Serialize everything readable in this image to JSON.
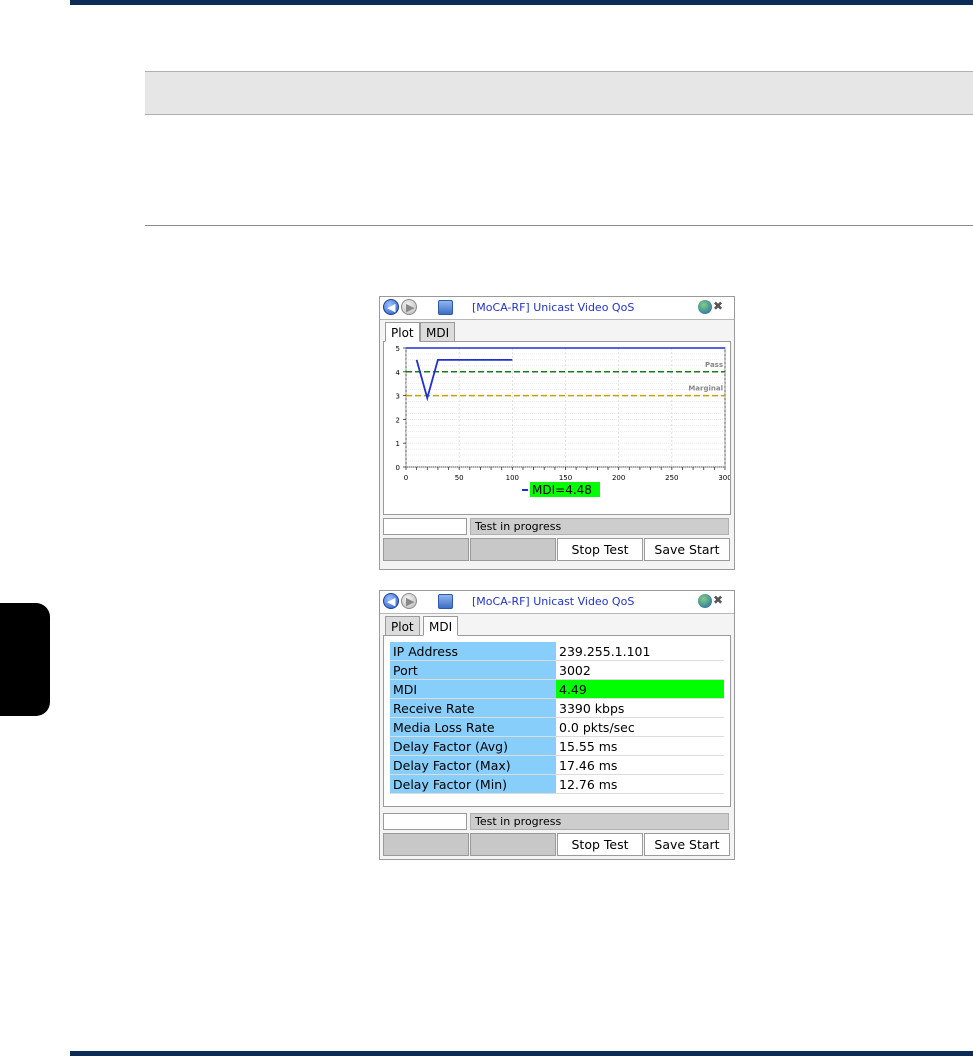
{
  "device_title": "[MoCA-RF] Unicast Video QoS",
  "tabs": [
    "Plot",
    "MDI"
  ],
  "status": "Test in progress",
  "softkeys": {
    "stop": "Stop Test",
    "save": "Save Start"
  },
  "plot": {
    "legend_label": "MDI=4.48",
    "pass_label": "Pass",
    "marginal_label": "Marginal"
  },
  "chart_data": {
    "type": "line",
    "x_ticks": [
      "0",
      "50",
      "100",
      "150",
      "200",
      "250",
      "300"
    ],
    "y_ticks": [
      "0",
      "1",
      "2",
      "3",
      "4",
      "5"
    ],
    "xlim": [
      0,
      300
    ],
    "ylim": [
      0,
      5
    ],
    "series": [
      {
        "name": "MDI=4.48",
        "color": "#1f2fd6",
        "x": [
          10,
          20,
          30,
          100
        ],
        "y": [
          4.5,
          2.9,
          4.5,
          4.5
        ]
      }
    ],
    "thresholds": [
      {
        "name": "Pass",
        "value": 4,
        "color": "#1a7a1a"
      },
      {
        "name": "Marginal",
        "value": 3,
        "color": "#c8a000"
      }
    ],
    "reference_line": {
      "value": 5,
      "color": "#1f2fd6"
    }
  },
  "mdi_table": [
    {
      "label": "IP Address",
      "value": "239.255.1.101"
    },
    {
      "label": "Port",
      "value": "3002"
    },
    {
      "label": "MDI",
      "value": "4.49",
      "highlight": true
    },
    {
      "label": "Receive Rate",
      "value": "3390 kbps"
    },
    {
      "label": "Media Loss Rate",
      "value": "0.0 pkts/sec"
    },
    {
      "label": "Delay Factor (Avg)",
      "value": "15.55 ms"
    },
    {
      "label": "Delay Factor (Max)",
      "value": "17.46 ms"
    },
    {
      "label": "Delay Factor (Min)",
      "value": "12.76 ms"
    }
  ],
  "colors": {
    "header_bar": "#0d2b57",
    "highlight": "#00ff00",
    "key_cell": "#87cefa"
  }
}
